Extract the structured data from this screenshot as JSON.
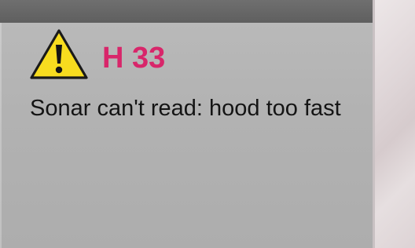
{
  "alert": {
    "icon": "warning-triangle-icon",
    "code": "H 33",
    "message": "Sonar can't read: hood too fast"
  },
  "colors": {
    "code_text": "#d8266a",
    "icon_fill": "#f7dc1f",
    "icon_outline": "#1a1a1a",
    "panel_background": "#b4b4b4",
    "top_bar": "#676767"
  }
}
